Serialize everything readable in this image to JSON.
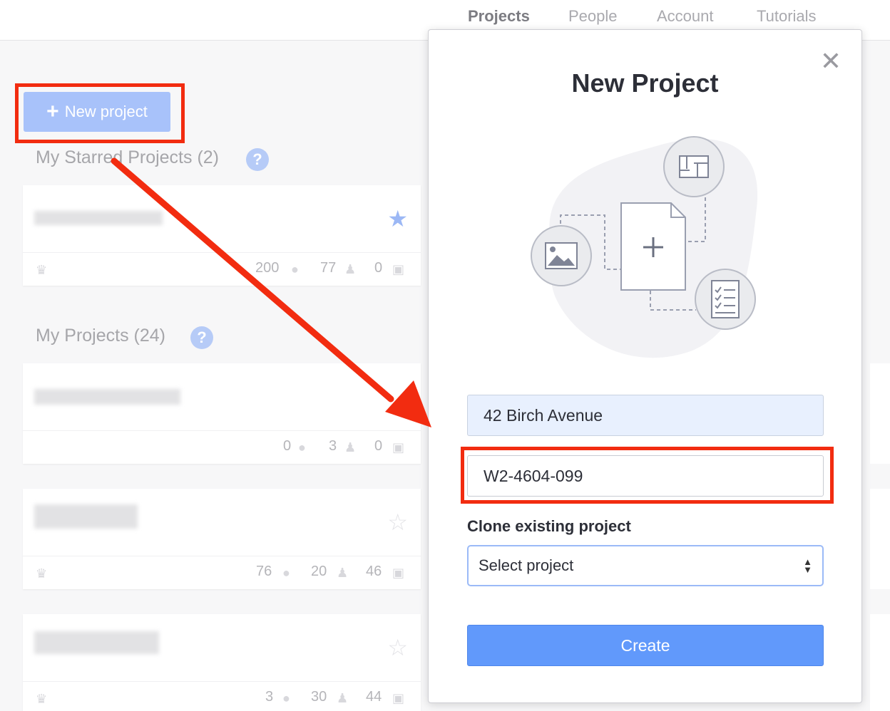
{
  "nav": {
    "items": [
      "Projects",
      "People",
      "Account",
      "Tutorials"
    ],
    "active": "Projects"
  },
  "left": {
    "new_project_label": "New project",
    "starred_title": "My Starred Projects (2)",
    "projects_title": "My Projects (24)",
    "help_glyph": "?",
    "starred_card": {
      "stats": [
        "200",
        "77",
        "0"
      ]
    },
    "project_cards": [
      {
        "stats": [
          "0",
          "3",
          "0"
        ]
      },
      {
        "stats": [
          "76",
          "20",
          "46"
        ]
      },
      {
        "stats": [
          "3",
          "30",
          "44"
        ]
      }
    ]
  },
  "modal": {
    "title": "New Project",
    "address_value": "42 Birch Avenue",
    "code_value": "W2-4604-099",
    "clone_label": "Clone existing project",
    "select_value": "Select project",
    "create_label": "Create"
  },
  "colors": {
    "accent": "#6199fb",
    "annotation": "#f22c10",
    "autofill": "#e8f0fe"
  }
}
